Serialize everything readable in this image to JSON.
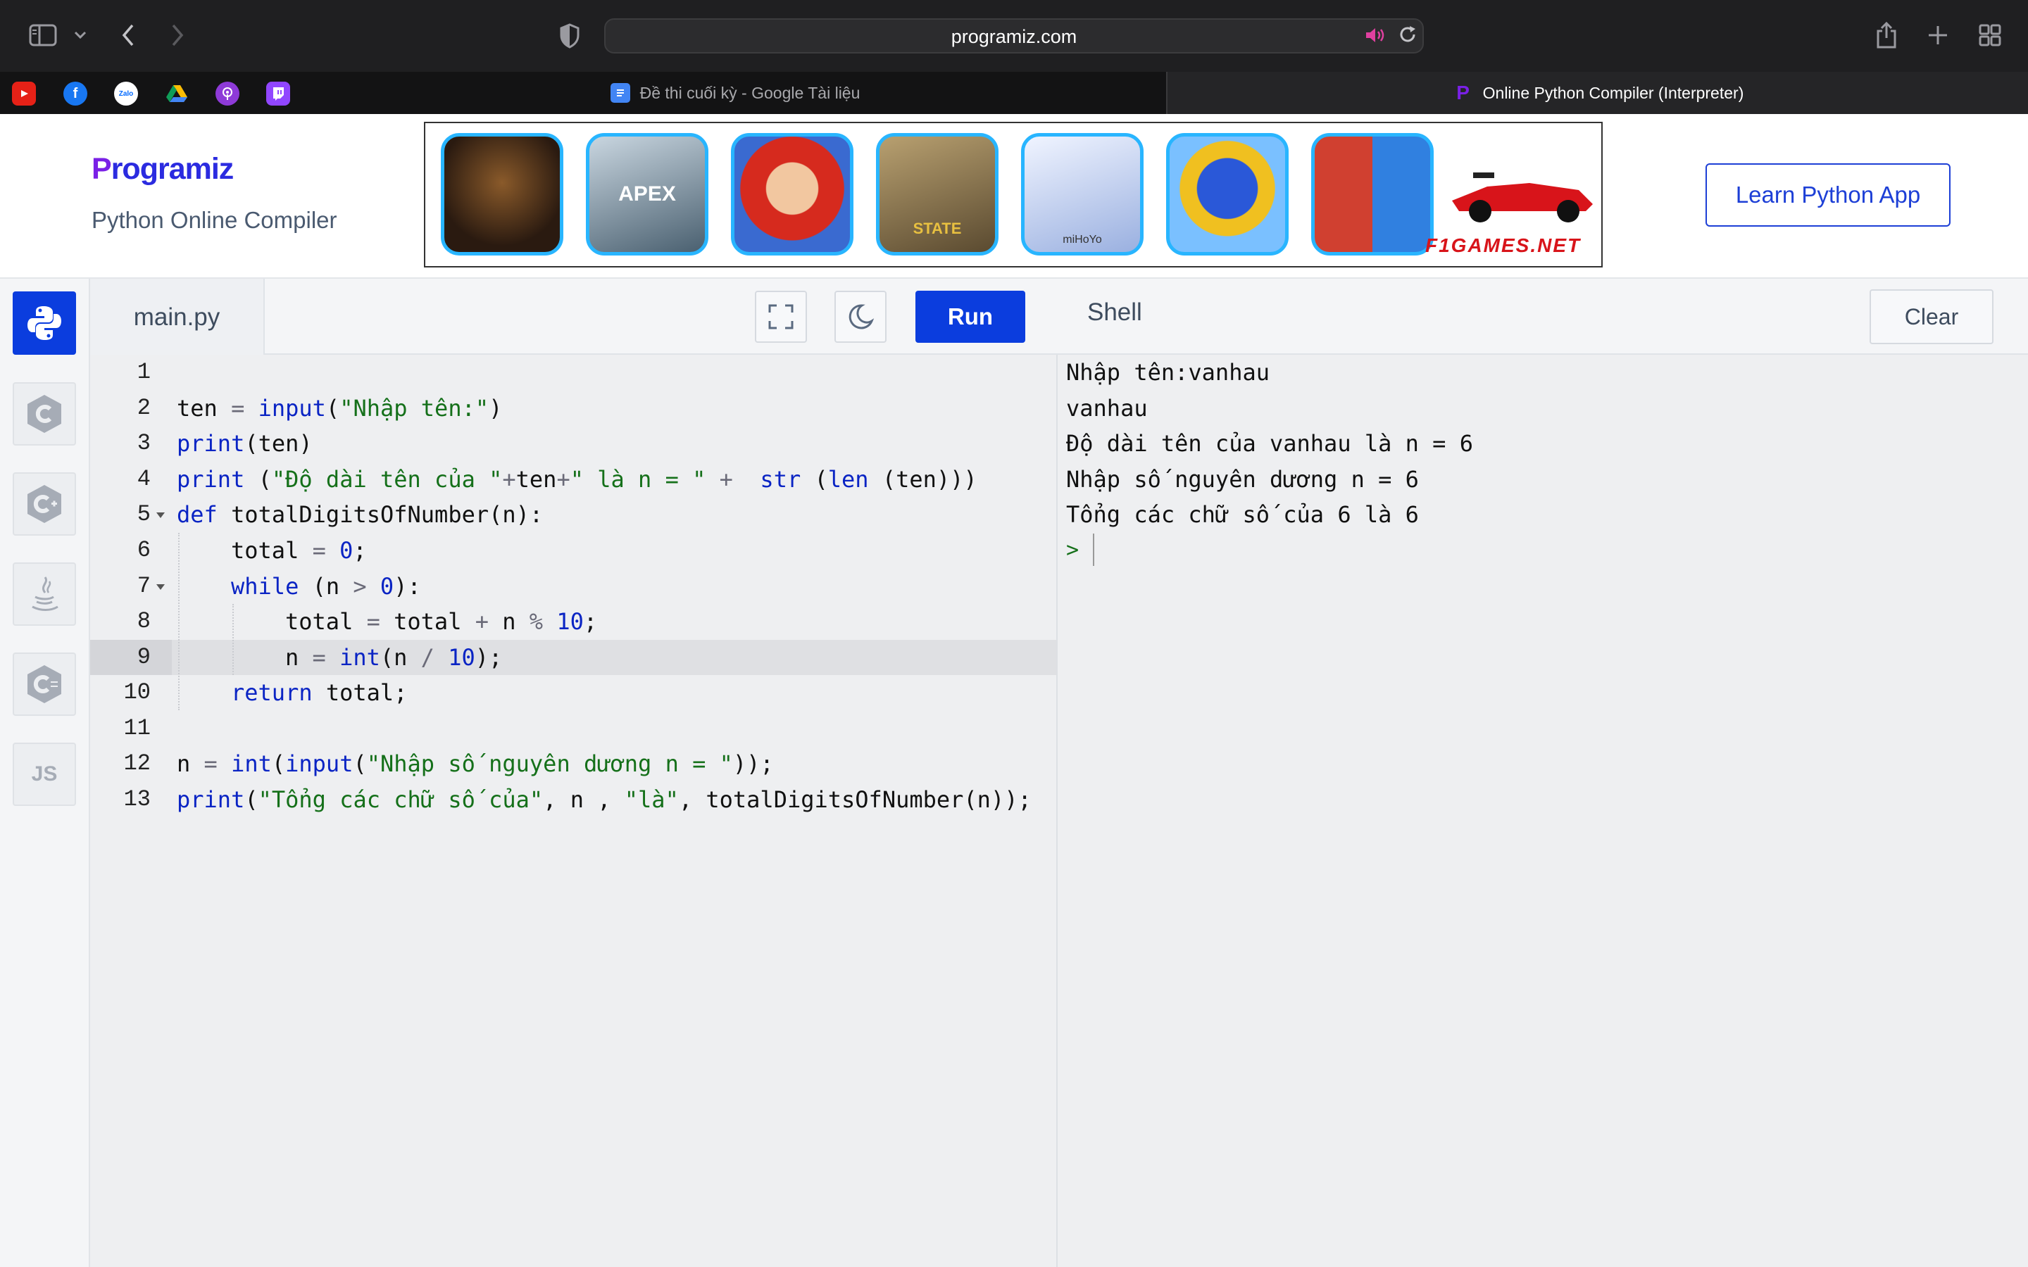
{
  "browser": {
    "url": "programiz.com",
    "tabs": [
      {
        "label": "Đề thi cuối kỳ - Google Tài liệu",
        "active": false
      },
      {
        "label": "Online Python Compiler (Interpreter)",
        "active": true
      }
    ],
    "favorites_icons": [
      "youtube-icon",
      "facebook-icon",
      "zalo-icon",
      "google-drive-icon",
      "podcasts-icon",
      "twitch-icon"
    ],
    "zalo_label": "Zalo"
  },
  "site": {
    "logo": "rogramiz",
    "logo_mark": "P",
    "subtitle": "Python Online Compiler",
    "ad_text": "F1GAMES.NET",
    "ad_game_labels": [
      "APEX",
      "STATE",
      "miHoYo"
    ],
    "learn_button": "Learn Python App",
    "colors": {
      "accent": "#0b3dde",
      "logo": "#2b2be0"
    }
  },
  "sidebar": {
    "languages": [
      {
        "name": "python",
        "active": true
      },
      {
        "name": "c",
        "active": false
      },
      {
        "name": "cpp",
        "active": false
      },
      {
        "name": "java",
        "active": false
      },
      {
        "name": "csharp",
        "active": false
      },
      {
        "name": "javascript",
        "label": "JS",
        "active": false
      }
    ]
  },
  "editor": {
    "filename": "main.py",
    "run_label": "Run",
    "active_line": 9,
    "line_numbers": [
      "1",
      "2",
      "3",
      "4",
      "5",
      "6",
      "7",
      "8",
      "9",
      "10",
      "11",
      "12",
      "13"
    ],
    "code": {
      "l2": {
        "a": "ten",
        "b": " = ",
        "c": "input",
        "d": "(",
        "e": "\"Nhập tên:\"",
        "f": ")"
      },
      "l3": {
        "a": "print",
        "b": "(ten)"
      },
      "l4": {
        "a": "print",
        "b": " (",
        "c": "\"Độ dài tên của \"",
        "d": "+",
        "e": "ten",
        "f": "+",
        "g": "\" là n = \"",
        "h": " + ",
        "i": " str",
        "j": " (",
        "k": "len",
        "l": " (ten)))"
      },
      "l5": {
        "a": "def",
        "b": " totalDigitsOfNumber(n):"
      },
      "l6": {
        "a": "total",
        "b": " = ",
        "c": "0",
        "d": ";"
      },
      "l7": {
        "a": "while",
        "b": " (n ",
        "c": ">",
        "d": " ",
        "e": "0",
        "f": "):"
      },
      "l8": {
        "a": "total",
        "b": " = ",
        "c": "total",
        "d": " + ",
        "e": "n",
        "f": " % ",
        "g": "10",
        "h": ";"
      },
      "l9": {
        "a": "n",
        "b": " = ",
        "c": "int",
        "d": "(n ",
        "e": "/",
        "f": " ",
        "g": "10",
        "h": ");"
      },
      "l10": {
        "a": "return",
        "b": " total;"
      },
      "l12": {
        "a": "n",
        "b": " = ",
        "c": "int",
        "d": "(",
        "e": "input",
        "f": "(",
        "g": "\"Nhập số nguyên dương n = \"",
        "h": "));"
      },
      "l13": {
        "a": "print",
        "b": "(",
        "c": "\"Tổng các chữ số của\"",
        "d": ", n , ",
        "e": "\"là\"",
        "f": ", totalDigitsOfNumber(n));"
      }
    }
  },
  "shell": {
    "title": "Shell",
    "clear_label": "Clear",
    "output": [
      "Nhập tên:vanhau",
      "vanhau",
      "Độ dài tên của vanhau là n = 6",
      "Nhập số nguyên dương n = 6",
      "Tổng các chữ số của 6 là 6"
    ],
    "prompt": ">"
  }
}
